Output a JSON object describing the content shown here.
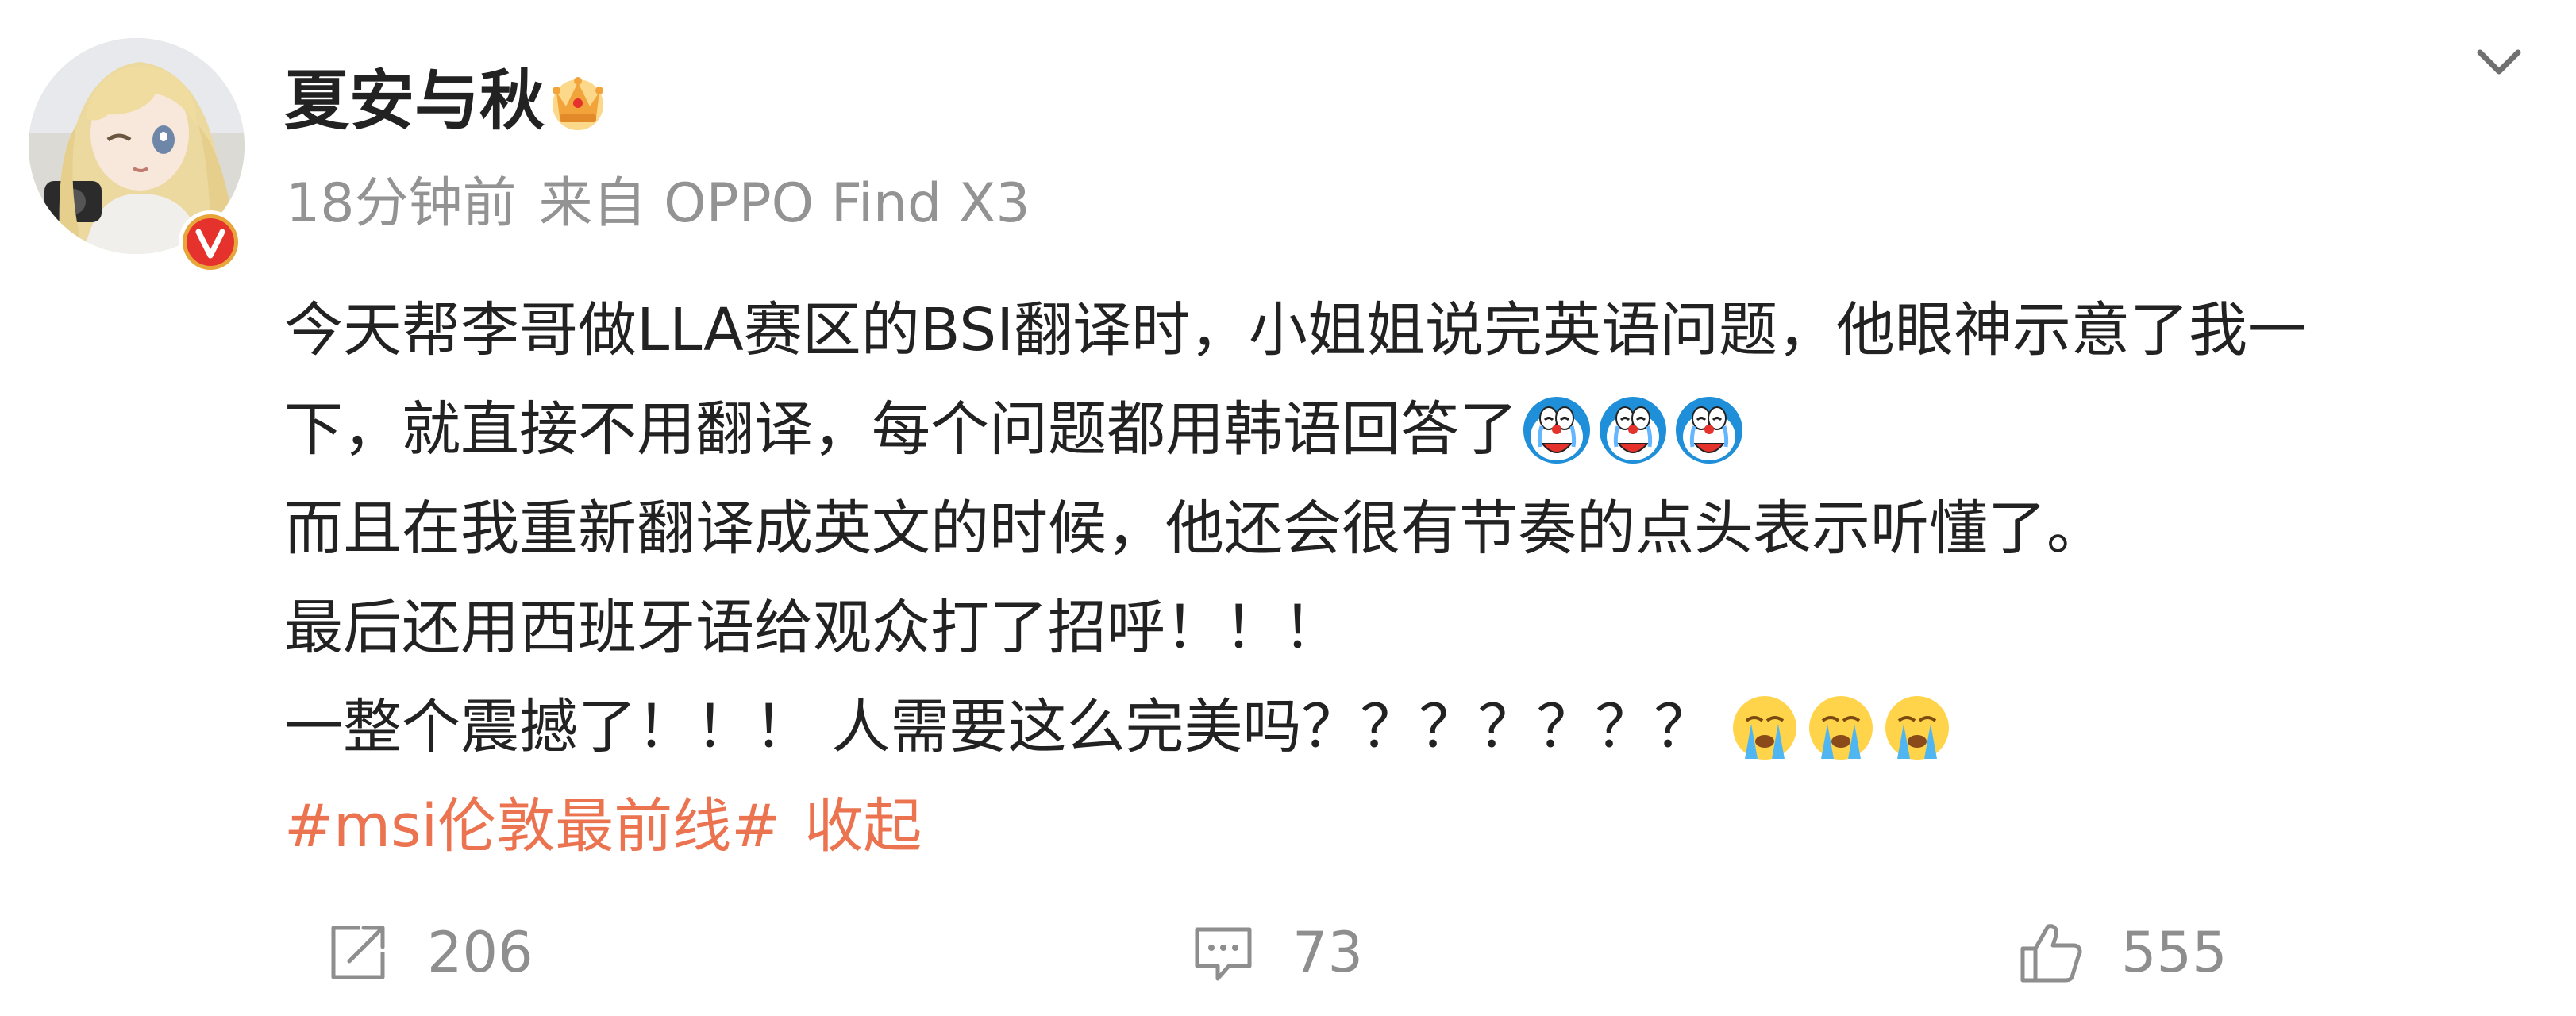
{
  "post": {
    "author": {
      "name": "夏安与秋",
      "verified": true,
      "crown_badge": "crown-icon"
    },
    "meta": {
      "time": "18分钟前",
      "source": "来自 OPPO Find X3"
    },
    "content": {
      "line1": "今天帮李哥做LLA赛区的BSI翻译时，小姐姐说完英语问题，他眼神示意了我一",
      "line2": "下，就直接不用翻译，每个问题都用韩语回答了",
      "line3": "而且在我重新翻译成英文的时候，他还会很有节奏的点头表示听懂了。",
      "line4": "最后还用西班牙语给观众打了招呼！！！",
      "line5": "一整个震撼了！！！ 人需要这么完美吗？？？？？？？",
      "hashtag": "#msi伦敦最前线#",
      "collapse": "收起"
    },
    "emojis": {
      "line2": [
        "doraemon-crying-emoji",
        "doraemon-crying-emoji",
        "doraemon-crying-emoji"
      ],
      "line5": [
        "crying-face-emoji",
        "crying-face-emoji",
        "crying-face-emoji"
      ]
    },
    "stats": {
      "reposts": "206",
      "comments": "73",
      "likes": "555"
    },
    "colors": {
      "text": "#222222",
      "meta": "#939393",
      "link": "#eb7350",
      "icon": "#8e8e8e"
    }
  }
}
